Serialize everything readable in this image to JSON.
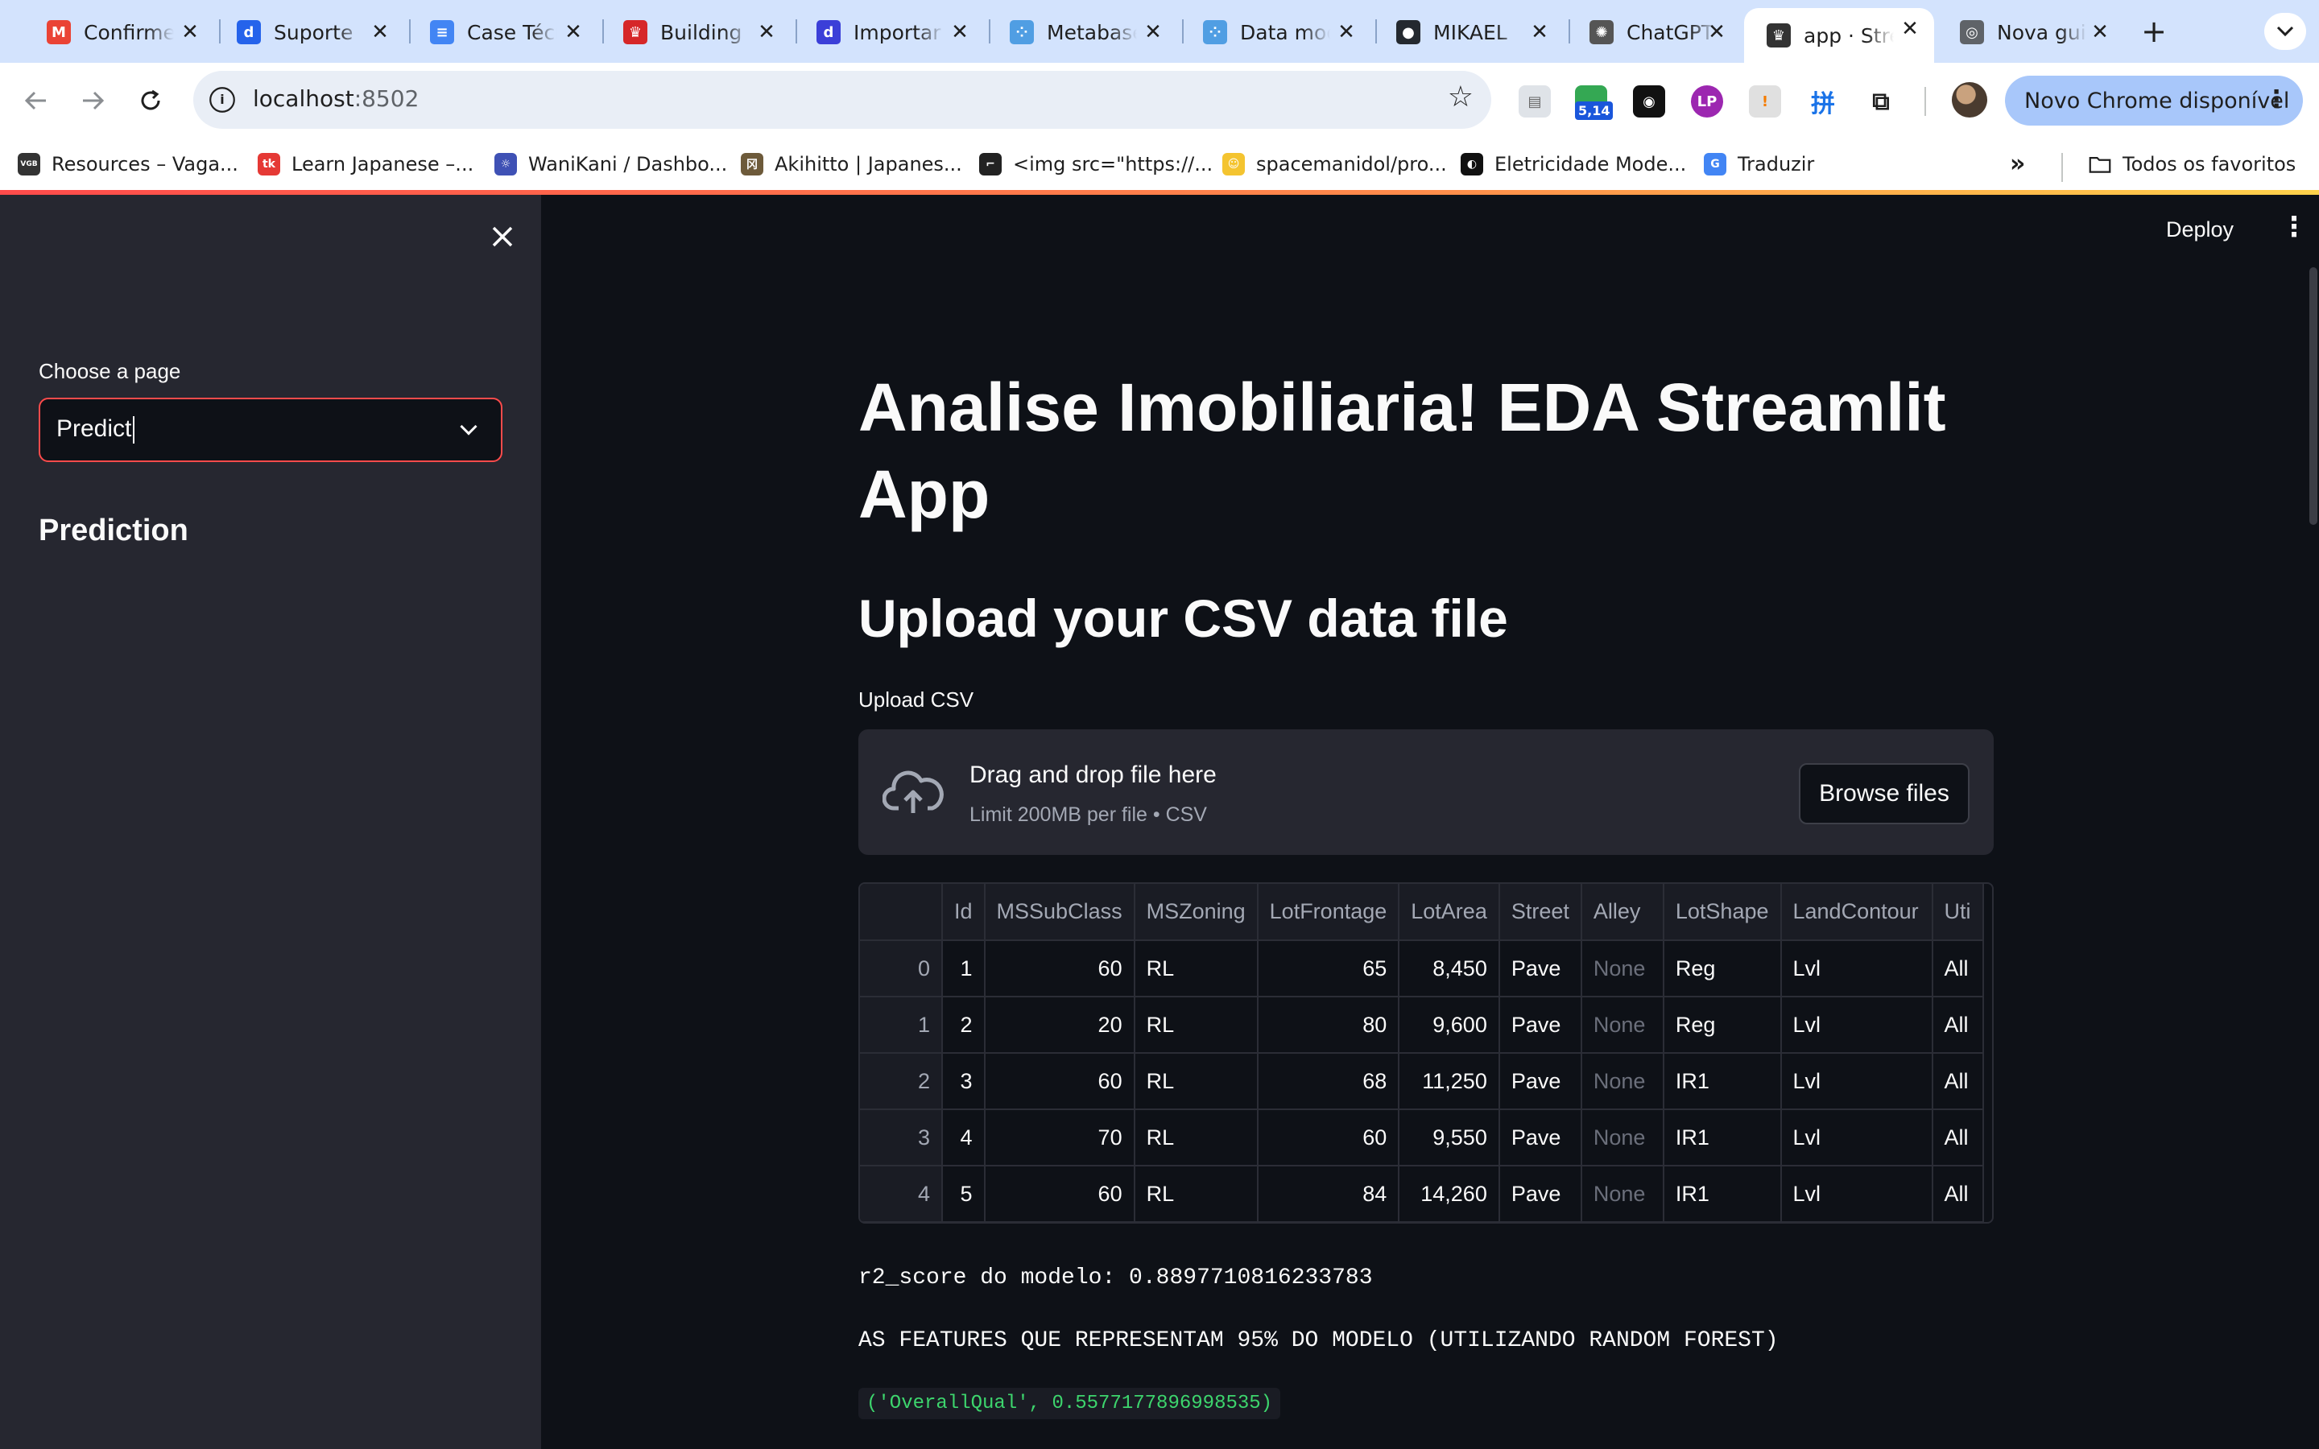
{
  "browser": {
    "tabs": [
      {
        "title": "Confirme",
        "icon": "gmail-icon",
        "color": "#ea4335",
        "glyph": "M"
      },
      {
        "title": "Suporte",
        "icon": "d-app-icon",
        "color": "#2563eb",
        "glyph": "d"
      },
      {
        "title": "Case Técnico",
        "icon": "docs-icon",
        "color": "#4285f4",
        "glyph": "≡"
      },
      {
        "title": "Building",
        "icon": "crown-icon",
        "color": "#d62728",
        "glyph": "♛"
      },
      {
        "title": "Importar",
        "icon": "d-app-icon",
        "color": "#3b3fd8",
        "glyph": "d"
      },
      {
        "title": "Metabase",
        "icon": "metabase-icon",
        "color": "#509ee3",
        "glyph": "⁘"
      },
      {
        "title": "Data model",
        "icon": "metabase-icon",
        "color": "#509ee3",
        "glyph": "⁘"
      },
      {
        "title": "MIKAEL",
        "icon": "github-icon",
        "color": "#24292f",
        "glyph": "●"
      },
      {
        "title": "ChatGPT",
        "icon": "openai-icon",
        "color": "#555555",
        "glyph": "✺"
      },
      {
        "title": "app · Streamlit",
        "icon": "streamlit-icon",
        "color": "#333333",
        "glyph": "♛",
        "active": true
      },
      {
        "title": "Nova guia",
        "icon": "chrome-icon",
        "color": "#5f6368",
        "glyph": "◎"
      }
    ],
    "new_tab_label": "+",
    "url_host": "localhost",
    "url_port": ":8502",
    "extension_badge": "5,14",
    "update_button": "Novo Chrome disponível",
    "bookmarks": [
      {
        "label": "Resources – Vaga...",
        "icon": "vgb-icon",
        "color": "#333333",
        "glyph": "VGB"
      },
      {
        "label": "Learn Japanese –...",
        "icon": "tk-icon",
        "color": "#e53935",
        "glyph": "tk"
      },
      {
        "label": "WaniKani / Dashbo...",
        "icon": "wanikani-icon",
        "color": "#3f51b5",
        "glyph": "☼"
      },
      {
        "label": "Akihitto | Japanes...",
        "icon": "akihitto-icon",
        "color": "#6d5a3a",
        "glyph": "冈"
      },
      {
        "label": "<img src=\"https://...",
        "icon": "image-link-icon",
        "color": "#222222",
        "glyph": "⌐"
      },
      {
        "label": "spacemanidol/pro...",
        "icon": "emoji-icon",
        "color": "#f4c430",
        "glyph": "☺"
      },
      {
        "label": "Eletricidade Mode...",
        "icon": "circle-icon",
        "color": "#111111",
        "glyph": "◐"
      },
      {
        "label": "Traduzir",
        "icon": "translate-icon",
        "color": "#4285f4",
        "glyph": "G"
      }
    ],
    "all_bookmarks": "Todos os favoritos"
  },
  "sidebar": {
    "select_label": "Choose a page",
    "select_value": "Predict",
    "heading": "Prediction"
  },
  "main": {
    "deploy": "Deploy",
    "title": "Analise Imobiliaria! EDA Streamlit App",
    "upload_heading": "Upload your CSV data file",
    "upload_label": "Upload CSV",
    "dropzone_title": "Drag and drop file here",
    "dropzone_sub": "Limit 200MB per file • CSV",
    "browse_button": "Browse files",
    "table": {
      "columns": [
        "",
        "Id",
        "MSSubClass",
        "MSZoning",
        "LotFrontage",
        "LotArea",
        "Street",
        "Alley",
        "LotShape",
        "LandContour",
        "Uti"
      ],
      "rows": [
        [
          "0",
          "1",
          "60",
          "RL",
          "65",
          "8,450",
          "Pave",
          "None",
          "Reg",
          "Lvl",
          "All"
        ],
        [
          "1",
          "2",
          "20",
          "RL",
          "80",
          "9,600",
          "Pave",
          "None",
          "Reg",
          "Lvl",
          "All"
        ],
        [
          "2",
          "3",
          "60",
          "RL",
          "68",
          "11,250",
          "Pave",
          "None",
          "IR1",
          "Lvl",
          "All"
        ],
        [
          "3",
          "4",
          "70",
          "RL",
          "60",
          "9,550",
          "Pave",
          "None",
          "IR1",
          "Lvl",
          "All"
        ],
        [
          "4",
          "5",
          "60",
          "RL",
          "84",
          "14,260",
          "Pave",
          "None",
          "IR1",
          "Lvl",
          "All"
        ]
      ]
    },
    "r2_text": "r2_score do modelo: 0.8897710816233783",
    "features_title": "AS FEATURES QUE REPRESENTAM 95% DO MODELO (UTILIZANDO RANDOM FOREST)",
    "feature_item": "('OverallQual', 0.5577177896998535)"
  },
  "colors": {
    "accent": "#ff4b4b",
    "sidebar_bg": "#262730",
    "main_bg": "#0e1117",
    "code_green": "#3dd56d"
  }
}
